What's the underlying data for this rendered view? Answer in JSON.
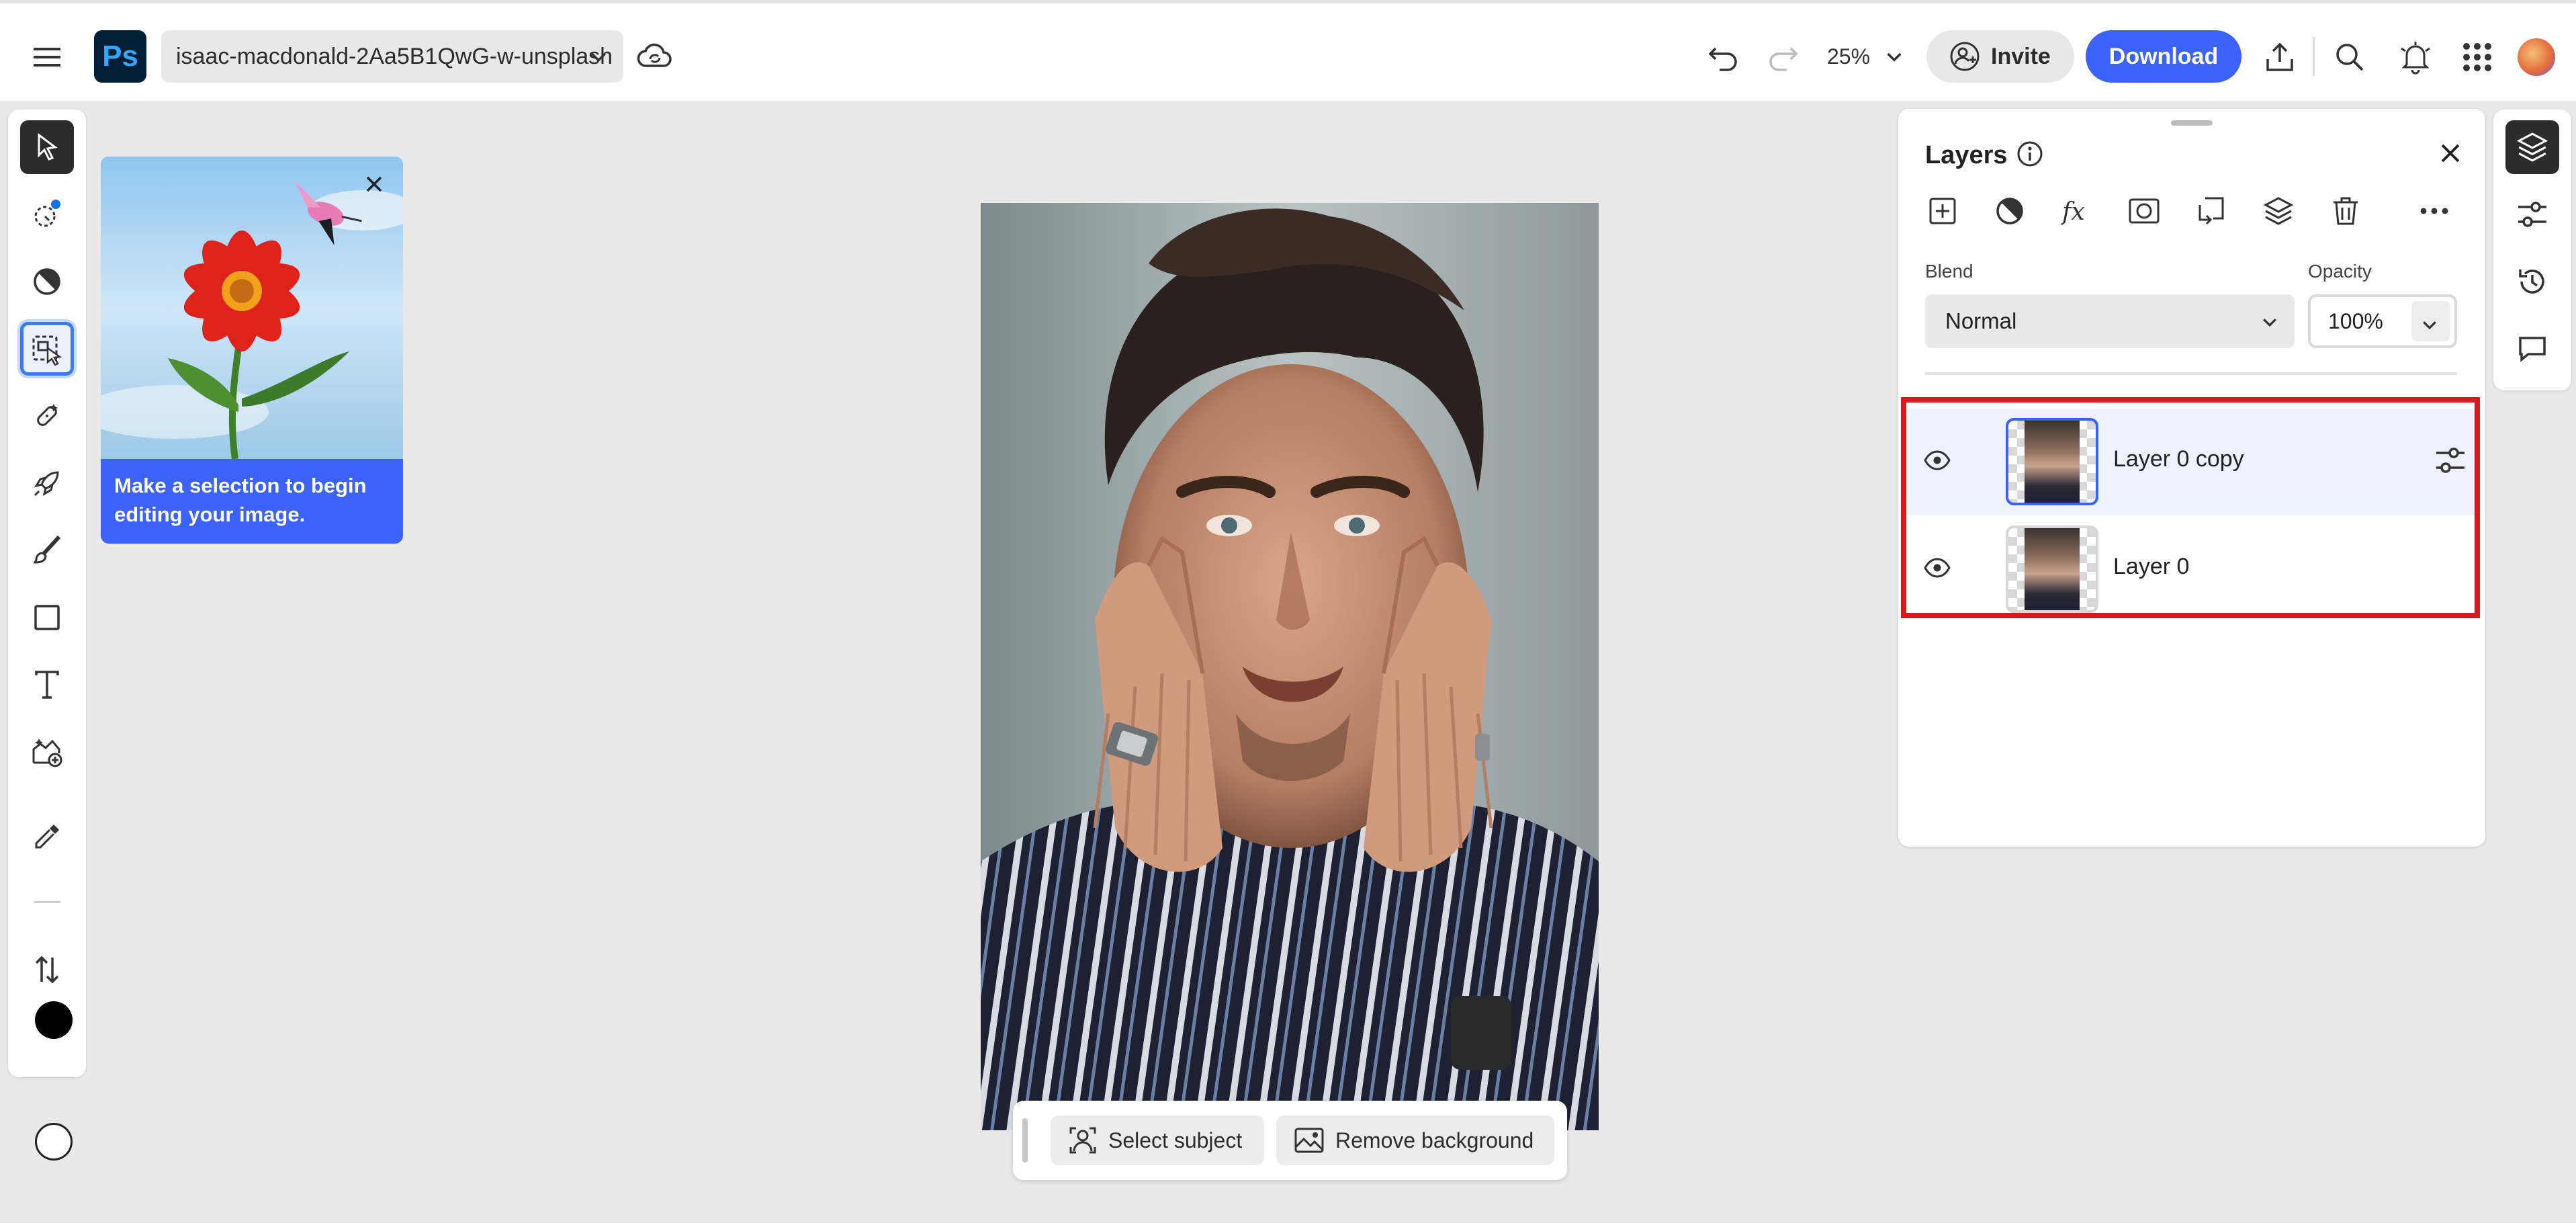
{
  "topbar": {
    "menu_icon": "hamburger-menu-icon",
    "app_logo": "Ps",
    "document_name": "isaac-macdonald-2Aa5B1QwG-w-unsplash",
    "zoom_level": "25%",
    "invite_label": "Invite",
    "download_label": "Download",
    "brand_color": "#3b63fb"
  },
  "left_toolbar": {
    "tools": [
      "move-tool",
      "quick-selection-tool",
      "adjustment-brush-tool",
      "object-selection-tool",
      "healing-tool",
      "quick-actions-tool",
      "brush-tool",
      "shape-tool",
      "type-tool",
      "generative-fill-tool",
      "eyedropper-tool",
      "foreground-color",
      "swap-colors",
      "background-color"
    ],
    "active_tool": "object-selection-tool",
    "foreground_color": "#000000",
    "background_color": "#ffffff"
  },
  "tip_card": {
    "text": "Make a selection to begin editing your image."
  },
  "context_bar": {
    "select_subject_label": "Select subject",
    "remove_background_label": "Remove background"
  },
  "layers_panel": {
    "title": "Layers",
    "blend_label": "Blend",
    "blend_value": "Normal",
    "opacity_label": "Opacity",
    "opacity_value": "100%",
    "layers": [
      {
        "name": "Layer 0 copy",
        "visible": true,
        "selected": true
      },
      {
        "name": "Layer 0",
        "visible": true,
        "selected": false
      }
    ]
  },
  "right_rail": {
    "items": [
      "layers-icon",
      "adjustments-icon",
      "history-icon",
      "comments-icon"
    ],
    "active": "layers-icon"
  }
}
